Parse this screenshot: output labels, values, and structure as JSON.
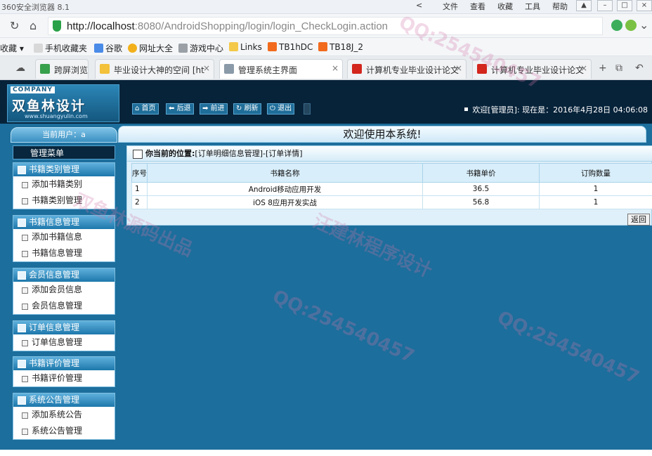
{
  "browser": {
    "title": "360安全浏览器 8.1",
    "menus": [
      "文件",
      "查看",
      "收藏",
      "工具",
      "帮助"
    ],
    "url_host": "http://localhost",
    "url_path": ":8080/AndroidShopping/login/login_CheckLogin.action",
    "favorites": [
      "收藏",
      "手机收藏夹",
      "谷歌",
      "网址大全",
      "游戏中心",
      "Links",
      "TB1hDC",
      "TB18J_2"
    ],
    "tabs": [
      {
        "label": "跨屏浏览",
        "active": false
      },
      {
        "label": "毕业设计大神的空间 [ht",
        "active": false
      },
      {
        "label": "管理系统主界面",
        "active": true
      },
      {
        "label": "计算机专业毕业设计论文",
        "active": false
      },
      {
        "label": "计算机专业毕业设计论文",
        "active": false
      }
    ]
  },
  "header": {
    "company": "COMPANY",
    "brand": "双鱼林设计",
    "website": "www.shuangyulin.com",
    "buttons": [
      "首页",
      "后退",
      "前进",
      "刷新",
      "退出"
    ],
    "welcome": "欢迎[管理员]:  现在是：2016年4月28日 04:06:08"
  },
  "sidebar": {
    "current_user": "当前用户：a",
    "menu_title": "管理菜单",
    "groups": [
      {
        "title": "书籍类别管理",
        "items": [
          "添加书籍类别",
          "书籍类别管理"
        ]
      },
      {
        "title": "书籍信息管理",
        "items": [
          "添加书籍信息",
          "书籍信息管理"
        ]
      },
      {
        "title": "会员信息管理",
        "items": [
          "添加会员信息",
          "会员信息管理"
        ]
      },
      {
        "title": "订单信息管理",
        "items": [
          "订单信息管理"
        ]
      },
      {
        "title": "书籍评价管理",
        "items": [
          "书籍评价管理"
        ]
      },
      {
        "title": "系统公告管理",
        "items": [
          "添加系统公告",
          "系统公告管理"
        ]
      }
    ]
  },
  "main": {
    "welcome_title": "欢迎使用本系统!",
    "position_label": "你当前的位置:",
    "position_path": "[订单明细信息管理]-[订单详情]",
    "columns": [
      "序号",
      "书籍名称",
      "书籍单价",
      "订购数量"
    ],
    "rows": [
      [
        "1",
        "Android移动应用开发",
        "36.5",
        "1"
      ],
      [
        "2",
        "iOS 8应用开发实战",
        "56.8",
        "1"
      ]
    ],
    "back_button": "返回"
  },
  "watermarks": [
    "QQ:254540457",
    "双鱼林源码出品",
    "汪建林程序设计"
  ]
}
